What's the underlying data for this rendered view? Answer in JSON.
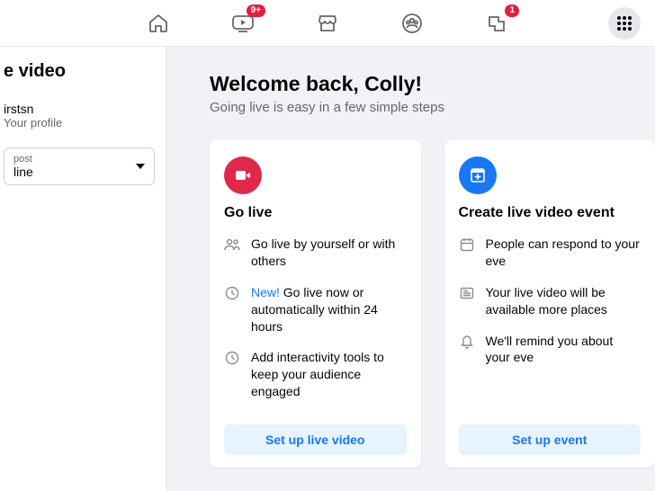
{
  "nav": {
    "watch_badge": "9+",
    "groups_badge": "1"
  },
  "sidebar": {
    "title": "e video",
    "username": "irstsn",
    "profile_sub": "Your profile",
    "select_label": "post",
    "select_value": "line"
  },
  "main": {
    "welcome": "Welcome back, Colly!",
    "subtitle": "Going live is easy in a few simple steps",
    "card_live": {
      "title": "Go live",
      "feat1": "Go live by yourself or with others",
      "feat2_new": "New!",
      "feat2_rest": " Go live now or automatically within 24 hours",
      "feat3": "Add interactivity tools to keep your audience engaged",
      "cta": "Set up live video"
    },
    "card_event": {
      "title": "Create live video event",
      "feat1": "People can respond to your eve",
      "feat2": "Your live video will be available more places",
      "feat3": "We'll remind you about your eve",
      "cta": "Set up event"
    }
  }
}
